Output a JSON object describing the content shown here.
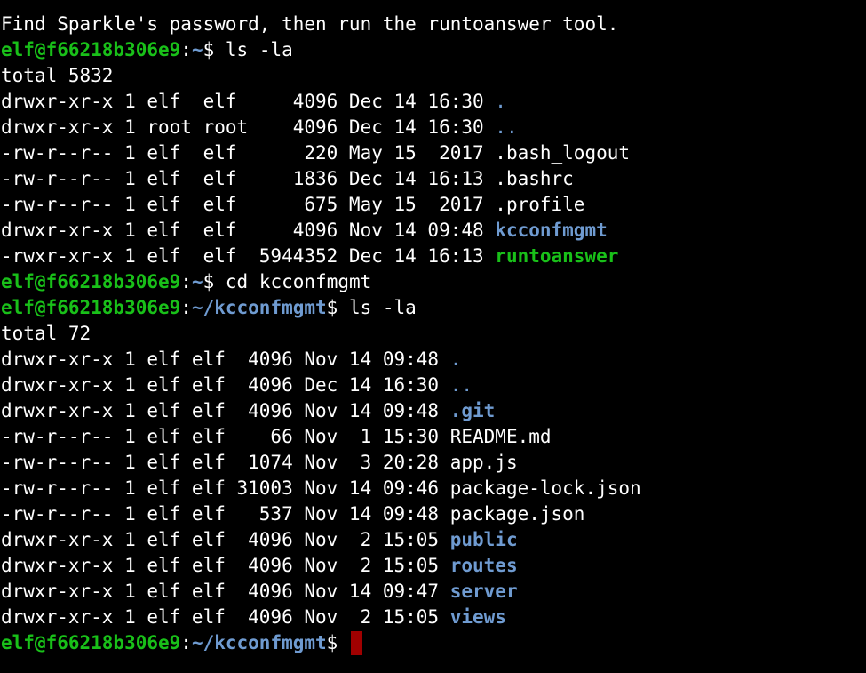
{
  "colors": {
    "background": "#000000",
    "text": "#ffffff",
    "prompt_green": "#19c019",
    "directory_blue": "#6f9bd1",
    "cursor_red": "#a00000"
  },
  "terminal": {
    "intro": "Find Sparkle's password, then run the runtoanswer tool.",
    "prompt_user": "elf@f66218b306e9",
    "prompt_sep": ":",
    "paths": {
      "home": "~",
      "kcconfmgmt": "~/kcconfmgmt"
    },
    "prompt_symbol": "$",
    "commands": {
      "ls1": " ls -la",
      "cd": " cd kcconfmgmt",
      "ls2": " ls -la",
      "current": " "
    },
    "listing1": {
      "total": "total 5832",
      "rows": [
        {
          "meta": "drwxr-xr-x 1 elf  elf     4096 Dec 14 16:30 ",
          "name": ".",
          "kind": "dir"
        },
        {
          "meta": "drwxr-xr-x 1 root root    4096 Dec 14 16:30 ",
          "name": "..",
          "kind": "dir"
        },
        {
          "meta": "-rw-r--r-- 1 elf  elf      220 May 15  2017 ",
          "name": ".bash_logout",
          "kind": "file"
        },
        {
          "meta": "-rw-r--r-- 1 elf  elf     1836 Dec 14 16:13 ",
          "name": ".bashrc",
          "kind": "file"
        },
        {
          "meta": "-rw-r--r-- 1 elf  elf      675 May 15  2017 ",
          "name": ".profile",
          "kind": "file"
        },
        {
          "meta": "drwxr-xr-x 1 elf  elf     4096 Nov 14 09:48 ",
          "name": "kcconfmgmt",
          "kind": "dirbold"
        },
        {
          "meta": "-rwxr-xr-x 1 elf  elf  5944352 Dec 14 16:13 ",
          "name": "runtoanswer",
          "kind": "exec"
        }
      ]
    },
    "listing2": {
      "total": "total 72",
      "rows": [
        {
          "meta": "drwxr-xr-x 1 elf elf  4096 Nov 14 09:48 ",
          "name": ".",
          "kind": "dir"
        },
        {
          "meta": "drwxr-xr-x 1 elf elf  4096 Dec 14 16:30 ",
          "name": "..",
          "kind": "dir"
        },
        {
          "meta": "drwxr-xr-x 1 elf elf  4096 Nov 14 09:48 ",
          "name": ".git",
          "kind": "dirbold"
        },
        {
          "meta": "-rw-r--r-- 1 elf elf    66 Nov  1 15:30 ",
          "name": "README.md",
          "kind": "file"
        },
        {
          "meta": "-rw-r--r-- 1 elf elf  1074 Nov  3 20:28 ",
          "name": "app.js",
          "kind": "file"
        },
        {
          "meta": "-rw-r--r-- 1 elf elf 31003 Nov 14 09:46 ",
          "name": "package-lock.json",
          "kind": "file"
        },
        {
          "meta": "-rw-r--r-- 1 elf elf   537 Nov 14 09:48 ",
          "name": "package.json",
          "kind": "file"
        },
        {
          "meta": "drwxr-xr-x 1 elf elf  4096 Nov  2 15:05 ",
          "name": "public",
          "kind": "dirbold"
        },
        {
          "meta": "drwxr-xr-x 1 elf elf  4096 Nov  2 15:05 ",
          "name": "routes",
          "kind": "dirbold"
        },
        {
          "meta": "drwxr-xr-x 1 elf elf  4096 Nov 14 09:47 ",
          "name": "server",
          "kind": "dirbold"
        },
        {
          "meta": "drwxr-xr-x 1 elf elf  4096 Nov  2 15:05 ",
          "name": "views",
          "kind": "dirbold"
        }
      ]
    }
  }
}
